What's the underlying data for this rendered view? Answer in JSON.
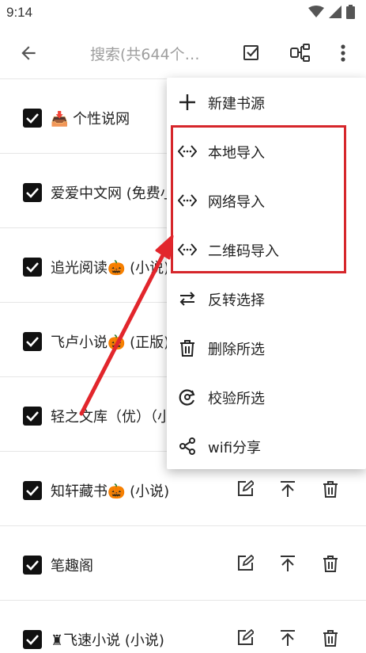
{
  "status": {
    "time": "9:14"
  },
  "toolbar": {
    "search_placeholder": "搜索(共644个…",
    "back_icon": "arrow-left-icon",
    "select_icon": "checkbox-edit-icon",
    "group_icon": "group-structure-icon",
    "more_icon": "more-vertical-icon"
  },
  "list": {
    "items": [
      {
        "label": "📥 个性说网",
        "checked": true,
        "actions": false
      },
      {
        "label": "爱爱中文网 (免费小",
        "checked": true,
        "actions": false
      },
      {
        "label": "追光阅读🎃 (小说)",
        "checked": true,
        "actions": false
      },
      {
        "label": "飞卢小说🎃 (正版)",
        "checked": true,
        "actions": false
      },
      {
        "label": "轻之文库（优）（小",
        "checked": true,
        "actions": false
      },
      {
        "label": "知轩藏书🎃 (小说)",
        "checked": true,
        "actions": true
      },
      {
        "label": "笔趣阁",
        "checked": true,
        "actions": true
      },
      {
        "label": "♜飞速小说 (小说)",
        "checked": true,
        "actions": true
      }
    ]
  },
  "menu": {
    "items": [
      {
        "label": "新建书源",
        "icon": "plus-icon"
      },
      {
        "label": "本地导入",
        "icon": "code-brackets-icon"
      },
      {
        "label": "网络导入",
        "icon": "code-brackets-icon"
      },
      {
        "label": "二维码导入",
        "icon": "code-brackets-icon"
      },
      {
        "label": "反转选择",
        "icon": "swap-arrows-icon"
      },
      {
        "label": "删除所选",
        "icon": "trash-icon"
      },
      {
        "label": "校验所选",
        "icon": "check-refresh-icon"
      },
      {
        "label": "wifi分享",
        "icon": "share-icon"
      }
    ]
  },
  "colors": {
    "highlight": "#d6262b",
    "arrow": "#e2262c"
  }
}
